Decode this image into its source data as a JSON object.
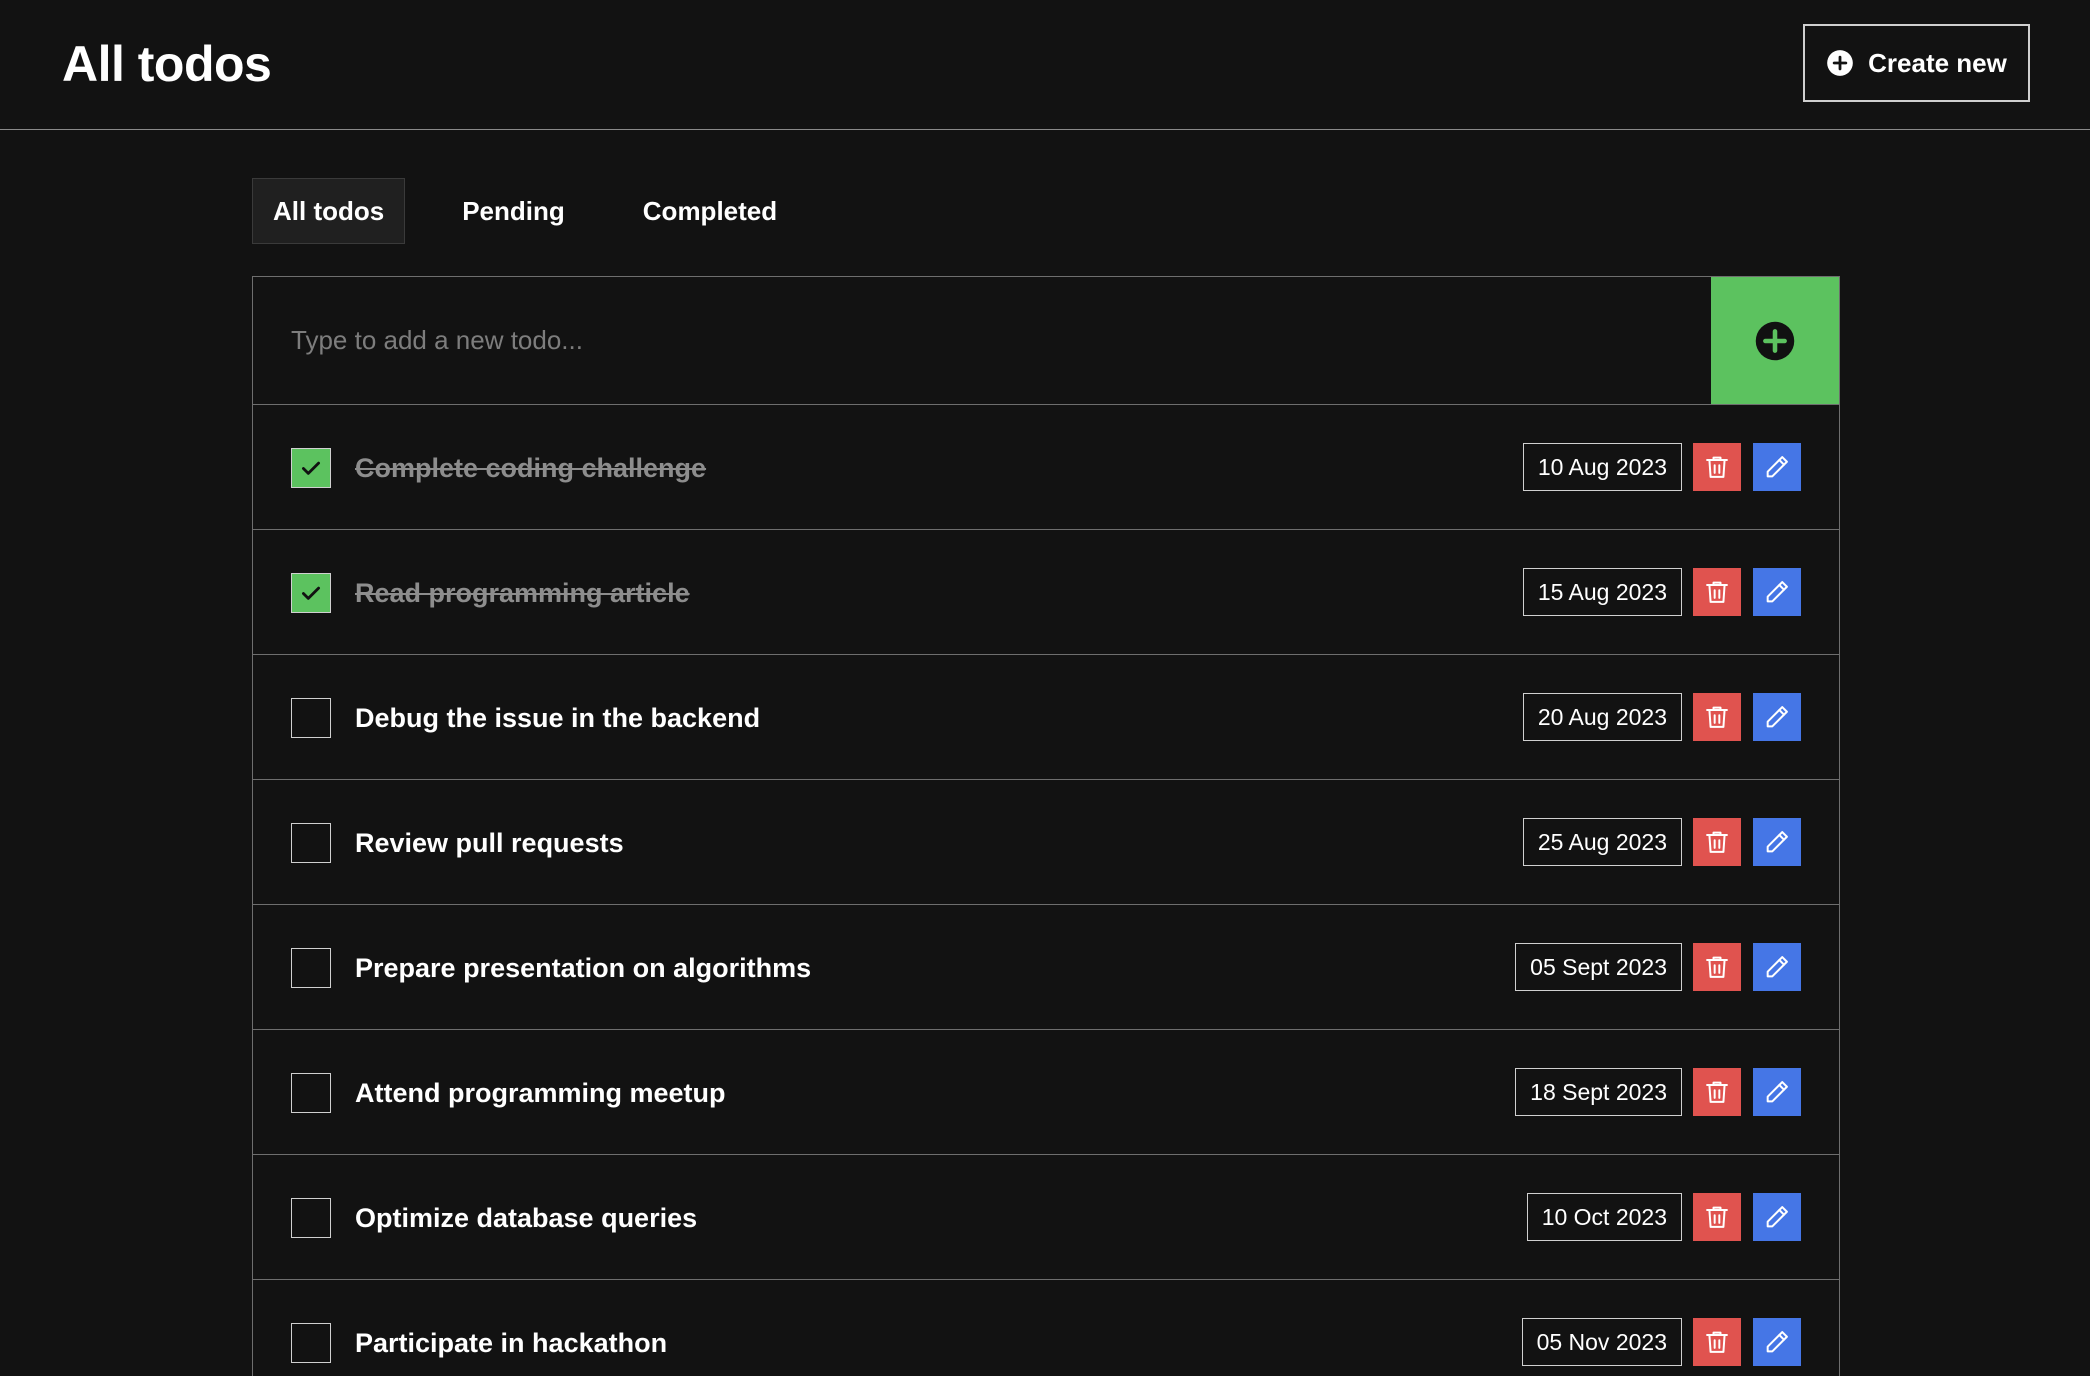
{
  "header": {
    "title": "All todos",
    "create_label": "Create new"
  },
  "tabs": [
    {
      "label": "All todos",
      "active": true
    },
    {
      "label": "Pending",
      "active": false
    },
    {
      "label": "Completed",
      "active": false
    }
  ],
  "new_todo": {
    "placeholder": "Type to add a new todo..."
  },
  "todos": [
    {
      "title": "Complete coding challenge",
      "date": "10 Aug 2023",
      "completed": true
    },
    {
      "title": "Read programming article",
      "date": "15 Aug 2023",
      "completed": true
    },
    {
      "title": "Debug the issue in the backend",
      "date": "20 Aug 2023",
      "completed": false
    },
    {
      "title": "Review pull requests",
      "date": "25 Aug 2023",
      "completed": false
    },
    {
      "title": "Prepare presentation on algorithms",
      "date": "05 Sept 2023",
      "completed": false
    },
    {
      "title": "Attend programming meetup",
      "date": "18 Sept 2023",
      "completed": false
    },
    {
      "title": "Optimize database queries",
      "date": "10 Oct 2023",
      "completed": false
    },
    {
      "title": "Participate in hackathon",
      "date": "05 Nov 2023",
      "completed": false
    }
  ],
  "colors": {
    "background": "#121212",
    "accent_green": "#5cc25f",
    "delete_red": "#e0534f",
    "edit_blue": "#4576e6"
  },
  "icons": {
    "create": "plus-circle-icon",
    "add": "plus-circle-icon",
    "check": "checkmark-icon",
    "delete": "trash-icon",
    "edit": "pencil-icon"
  }
}
